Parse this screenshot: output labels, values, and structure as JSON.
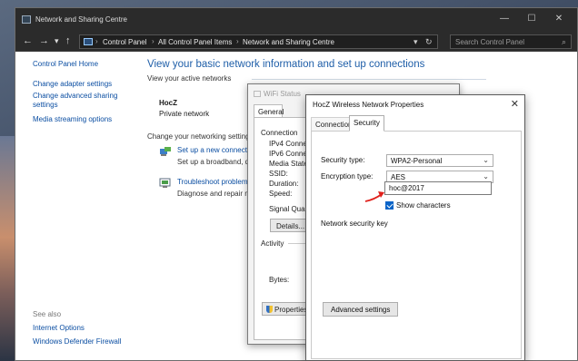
{
  "window": {
    "title": "Network and Sharing Centre",
    "minimize": "—",
    "maximize": "☐",
    "close": "✕"
  },
  "nav": {
    "back": "←",
    "forward": "→",
    "dropdown": "▾",
    "up": "↑",
    "breadcrumbs": [
      "Control Panel",
      "All Control Panel Items",
      "Network and Sharing Centre"
    ],
    "separator": "›",
    "refresh": "↻",
    "search_placeholder": "Search Control Panel"
  },
  "sidebar": {
    "items": [
      "Control Panel Home",
      "Change adapter settings",
      "Change advanced sharing settings",
      "Media streaming options"
    ],
    "see_also_label": "See also",
    "see_also": [
      "Internet Options",
      "Windows Defender Firewall"
    ]
  },
  "main": {
    "title": "View your basic network information and set up connections",
    "active_networks_label": "View your active networks",
    "network_name": "HocZ",
    "network_type": "Private network",
    "change_settings_label": "Change your networking settings",
    "tasks": [
      {
        "link": "Set up a new connectio",
        "desc": "Set up a broadband, di"
      },
      {
        "link": "Troubleshoot problems",
        "desc": "Diagnose and repair ne"
      }
    ]
  },
  "wifi_status": {
    "title": "WiFi Status",
    "tab": "General",
    "connection_label": "Connection",
    "rows": [
      "IPv4 Connect",
      "IPv6 Connect",
      "Media State:",
      "SSID:",
      "Duration:",
      "Speed:"
    ],
    "signal_quality": "Signal Quality",
    "details_button": "Details...",
    "activity_label": "Activity",
    "bytes_label": "Bytes:",
    "properties_button": "Properties"
  },
  "properties": {
    "title": "HocZ Wireless Network Properties",
    "tabs": [
      "Connection",
      "Security"
    ],
    "security_type_label": "Security type:",
    "security_type_value": "WPA2-Personal",
    "encryption_type_label": "Encryption type:",
    "encryption_type_value": "AES",
    "key_label": "Network security key",
    "key_value": "hoc@2017",
    "show_characters_label": "Show characters",
    "show_characters_checked": true,
    "advanced_button": "Advanced settings"
  },
  "colors": {
    "link": "#0b4ea2",
    "title_blue": "#1e5ea8",
    "annotation_arrow": "#e0201b",
    "checkbox_accent": "#0a64c8"
  }
}
